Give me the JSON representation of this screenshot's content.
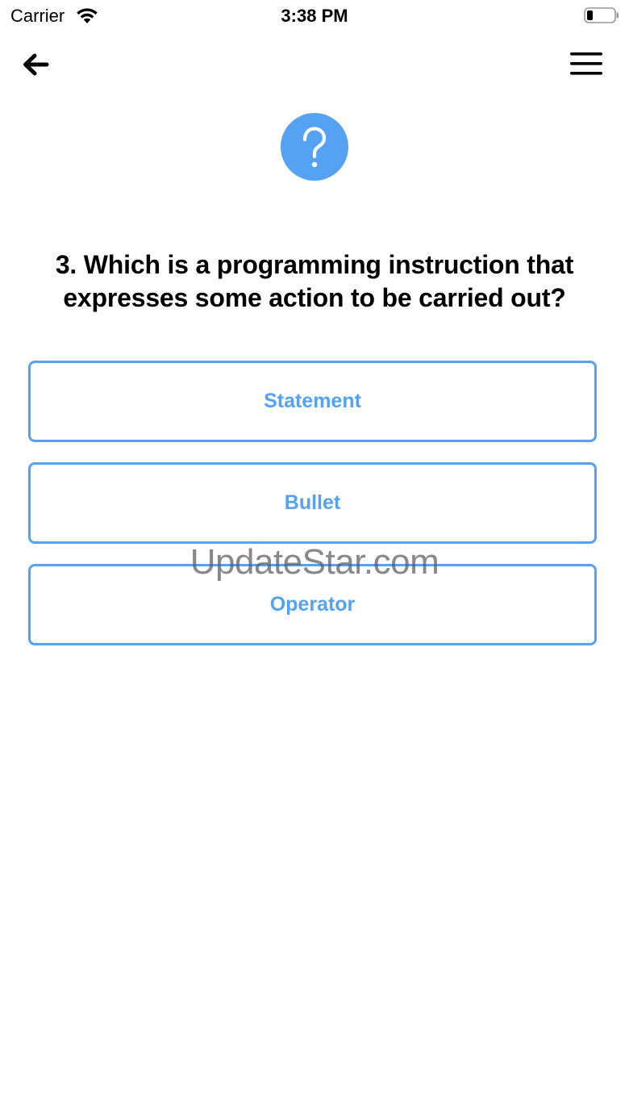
{
  "status_bar": {
    "carrier": "Carrier",
    "time": "3:38 PM",
    "icons": [
      "wifi-icon",
      "battery-icon"
    ]
  },
  "nav": {
    "back_icon": "arrow-left-icon",
    "menu_icon": "hamburger-menu-icon"
  },
  "question": {
    "icon": "question-mark-icon",
    "text": "3. Which is a programming instruction that expresses some action to be carried out?"
  },
  "answers": [
    {
      "label": "Statement"
    },
    {
      "label": "Bullet"
    },
    {
      "label": "Operator"
    }
  ],
  "watermark": "UpdateStar.com",
  "colors": {
    "accent": "#55a2f3",
    "text": "#000000",
    "background": "#ffffff"
  }
}
